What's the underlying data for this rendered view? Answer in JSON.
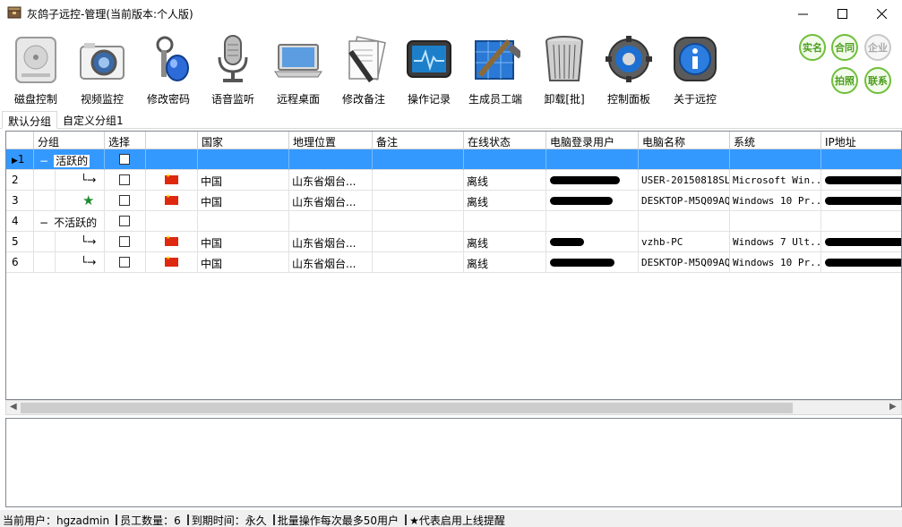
{
  "window": {
    "title": "灰鸽子远控-管理(当前版本:个人版)"
  },
  "toolbar": {
    "items": [
      {
        "label": "磁盘控制",
        "icon": "disk-icon"
      },
      {
        "label": "视频监控",
        "icon": "camera-icon"
      },
      {
        "label": "修改密码",
        "icon": "keys-icon"
      },
      {
        "label": "语音监听",
        "icon": "microphone-icon"
      },
      {
        "label": "远程桌面",
        "icon": "laptop-icon"
      },
      {
        "label": "修改备注",
        "icon": "note-pen-icon"
      },
      {
        "label": "操作记录",
        "icon": "monitor-pulse-icon"
      },
      {
        "label": "生成员工端",
        "icon": "build-tools-icon"
      },
      {
        "label": "卸载[批]",
        "icon": "trash-icon"
      },
      {
        "label": "控制面板",
        "icon": "gear-icon"
      },
      {
        "label": "关于远控",
        "icon": "info-icon"
      }
    ],
    "badges": {
      "realname": "实名",
      "contract": "合同",
      "enterprise": "企业",
      "photo": "拍照",
      "contact": "联系"
    }
  },
  "tabs": {
    "default": "默认分组",
    "custom": "自定义分组1"
  },
  "grid": {
    "columns": [
      "分组",
      "选择",
      "国家",
      "地理位置",
      "备注",
      "在线状态",
      "电脑登录用户",
      "电脑名称",
      "系统",
      "IP地址"
    ],
    "rows": [
      {
        "num": "1",
        "toggle": "−",
        "group": "活跃的"
      },
      {
        "num": "2",
        "tree": "└→",
        "country": "中国",
        "location": "山东省烟台...",
        "status": "离线",
        "computer": "USER-20150818SL",
        "os": "Microsoft Win..."
      },
      {
        "num": "3",
        "country": "中国",
        "location": "山东省烟台...",
        "status": "离线",
        "computer": "DESKTOP-M5Q09AQ",
        "os": "Windows 10 Pr..."
      },
      {
        "num": "4",
        "toggle": "−",
        "group": "不活跃的"
      },
      {
        "num": "5",
        "tree": "└→",
        "country": "中国",
        "location": "山东省烟台...",
        "status": "离线",
        "computer": "vzhb-PC",
        "os": "Windows 7 Ult..."
      },
      {
        "num": "6",
        "tree": "└→",
        "country": "中国",
        "location": "山东省烟台...",
        "status": "离线",
        "computer": "DESKTOP-M5Q09AQ",
        "os": "Windows 10 Pr..."
      }
    ]
  },
  "statusbar": {
    "user": "当前用户：hgzadmin",
    "staff": "员工数量：6",
    "expire": "到期时间：永久",
    "batch": "批量操作每次最多50用户",
    "star_note": "★代表启用上线提醒"
  },
  "colors": {
    "selection": "#3399ff",
    "badge_green": "#6fbf3a",
    "flag_red": "#de2910",
    "star_green": "#1e8c2e"
  }
}
